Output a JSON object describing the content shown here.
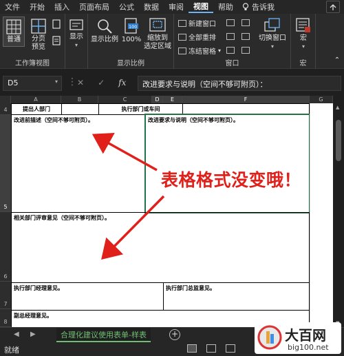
{
  "menu": {
    "items": [
      "文件",
      "开始",
      "插入",
      "页面布局",
      "公式",
      "数据",
      "审阅",
      "视图",
      "帮助"
    ],
    "active": "视图",
    "search_label": "告诉我"
  },
  "ribbon": {
    "workbook_views": {
      "label": "工作簿视图",
      "normal": "普通",
      "page_break_line1": "分页",
      "page_break_line2": "预览"
    },
    "show": {
      "label": "显示"
    },
    "zoom": {
      "label": "显示比例",
      "zoom": "显示比例",
      "hundred": "100%",
      "zoom_sel_line1": "缩放到",
      "zoom_sel_line2": "选定区域"
    },
    "window": {
      "label": "窗口",
      "new_window": "新建窗口",
      "arrange_all": "全部重排",
      "freeze": "冻结窗格",
      "switch_window": "切换窗口"
    },
    "macro": {
      "label": "宏",
      "macro": "宏"
    }
  },
  "formula_bar": {
    "name_box": "D5",
    "cancel_icon": "✕",
    "enter_icon": "✓",
    "fx": "fx",
    "content": "改进要求与说明（空间不够可附页）："
  },
  "columns": [
    "A",
    "B",
    "C",
    "D",
    "E",
    "F",
    "G"
  ],
  "selected_columns": [
    "D",
    "E",
    "F"
  ],
  "rows": [
    "4",
    "5",
    "6",
    "7",
    "8"
  ],
  "selected_rows": [
    "5"
  ],
  "cells": {
    "proposer_dept": "提出人部门",
    "exec_dept": "执行部门或车间",
    "improve_desc": "改进前描述（空间不够可附页）。",
    "improve_req": "改进要求与说明（空间不够可附页）。",
    "related_review": "相关部门评审意见（空间不够可附页）。",
    "exec_manager": "执行部门经理意见。",
    "exec_director": "执行部门总监意见。",
    "deputy_gm": "副总经理意见。"
  },
  "annotation": "表格格式没变哦！",
  "sheet_tab": "合理化建议使用表单-样表",
  "status": {
    "ready": "就绪"
  },
  "watermark": {
    "title": "大百网",
    "sub": "big100.net"
  },
  "colors": {
    "accent_green": "#217346",
    "annotation_red": "#e0201b",
    "tab_green": "#6fbf73"
  }
}
